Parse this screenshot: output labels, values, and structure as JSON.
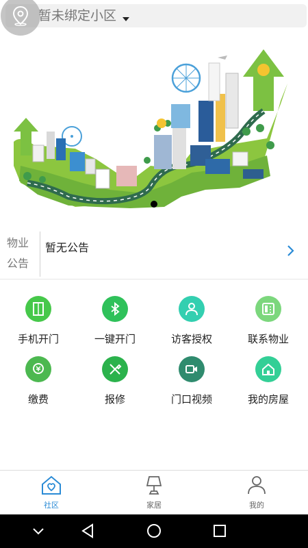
{
  "header": {
    "community_name": "暂未绑定小区",
    "location_icon": "location-pin-icon"
  },
  "notice": {
    "tag_line1": "物业",
    "tag_line2": "公告",
    "text": "暂无公告"
  },
  "services": [
    {
      "label": "手机开门",
      "icon": "door-icon",
      "color": "#46c84a"
    },
    {
      "label": "一键开门",
      "icon": "bluetooth-icon",
      "color": "#2fc15a"
    },
    {
      "label": "访客授权",
      "icon": "visitor-icon",
      "color": "#33cfb0"
    },
    {
      "label": "联系物业",
      "icon": "phone-icon",
      "color": "#7cd77d"
    },
    {
      "label": "缴费",
      "icon": "payment-icon",
      "color": "#4cb850"
    },
    {
      "label": "报修",
      "icon": "repair-icon",
      "color": "#2bb24c"
    },
    {
      "label": "门口视频",
      "icon": "video-icon",
      "color": "#2f8b6e"
    },
    {
      "label": "我的房屋",
      "icon": "house-icon",
      "color": "#33cf96"
    }
  ],
  "tabs": [
    {
      "label": "社区",
      "icon": "community-icon",
      "active": true
    },
    {
      "label": "家居",
      "icon": "lamp-icon",
      "active": false
    },
    {
      "label": "我的",
      "icon": "profile-icon",
      "active": false
    }
  ],
  "colors": {
    "accent": "#2a8bd6",
    "banner_green": "#7cc142",
    "road": "#3b7d5a"
  }
}
